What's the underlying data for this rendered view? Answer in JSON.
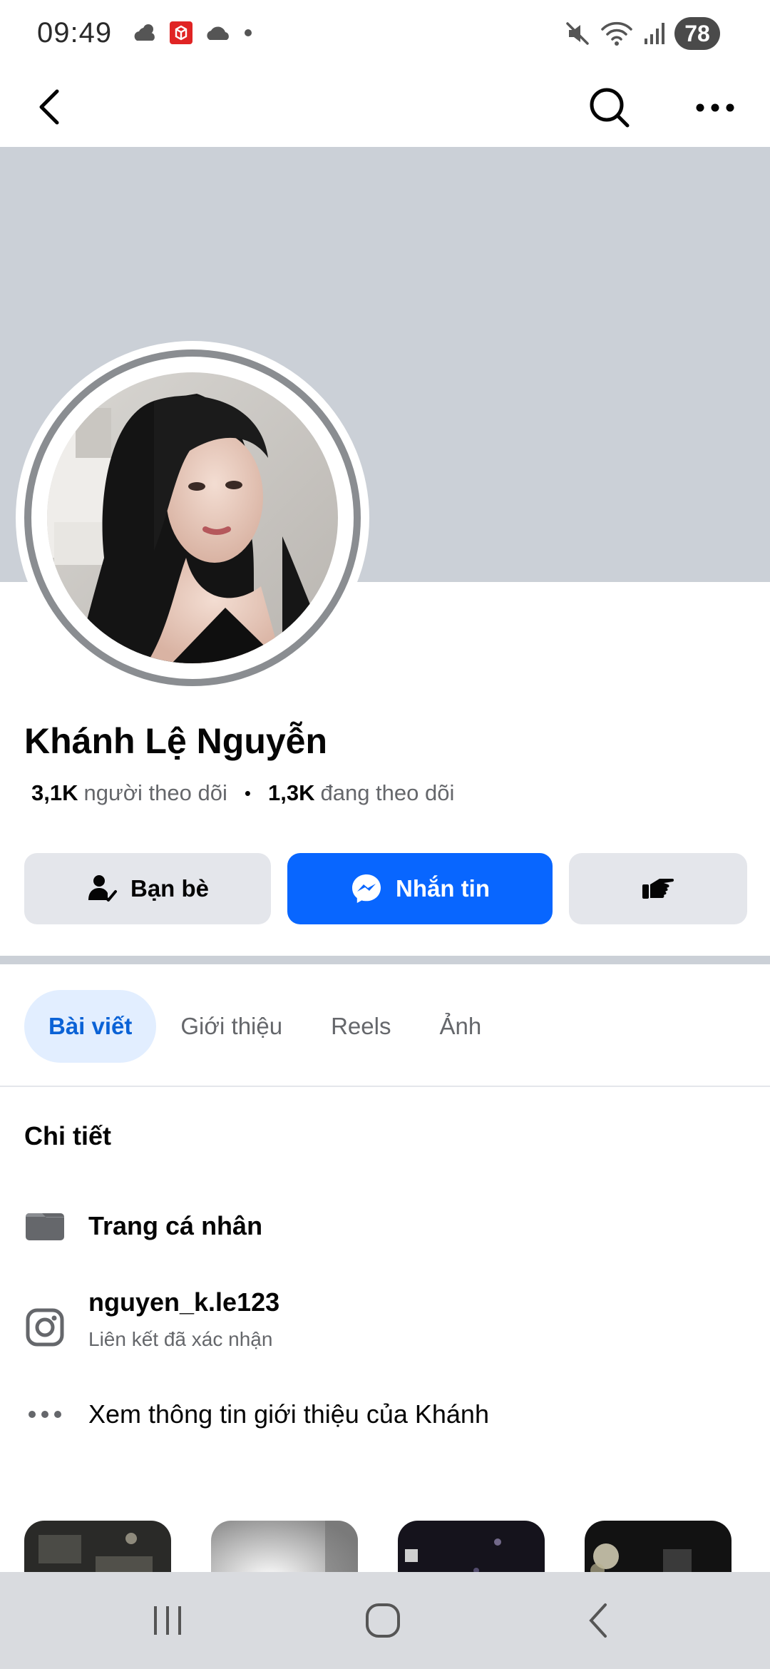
{
  "status_bar": {
    "time": "09:49",
    "battery": "78",
    "left_icons": [
      "cloud-weather-icon",
      "app-red-icon",
      "cloud-icon",
      "dot-icon"
    ],
    "right_icons": [
      "mute-icon",
      "wifi-icon",
      "signal-icon"
    ]
  },
  "header": {
    "back_icon": "back-arrow-icon",
    "search_icon": "search-icon",
    "more_icon": "more-icon"
  },
  "profile": {
    "name": "Khánh Lệ Nguyễn",
    "followers_count": "3,1K",
    "followers_label": "người theo dõi",
    "following_count": "1,3K",
    "following_label": "đang theo dõi"
  },
  "actions": {
    "friends_label": "Bạn bè",
    "message_label": "Nhắn tin",
    "message_color": "#0866ff"
  },
  "tabs": [
    {
      "label": "Bài viết",
      "active": true
    },
    {
      "label": "Giới thiệu",
      "active": false
    },
    {
      "label": "Reels",
      "active": false
    },
    {
      "label": "Ảnh",
      "active": false
    }
  ],
  "details": {
    "title": "Chi tiết",
    "items": [
      {
        "icon": "profile-card-icon",
        "label": "Trang cá nhân"
      },
      {
        "icon": "instagram-icon",
        "label": "nguyen_k.le123",
        "sub": "Liên kết đã xác nhận"
      },
      {
        "icon": "more-dots-icon",
        "label": "Xem thông tin giới thiệu của Khánh"
      }
    ]
  },
  "colors": {
    "accent": "#0866ff",
    "active_tab_bg": "#e2eeff",
    "active_tab_text": "#0a62d6",
    "cover": "#cbd0d7"
  }
}
